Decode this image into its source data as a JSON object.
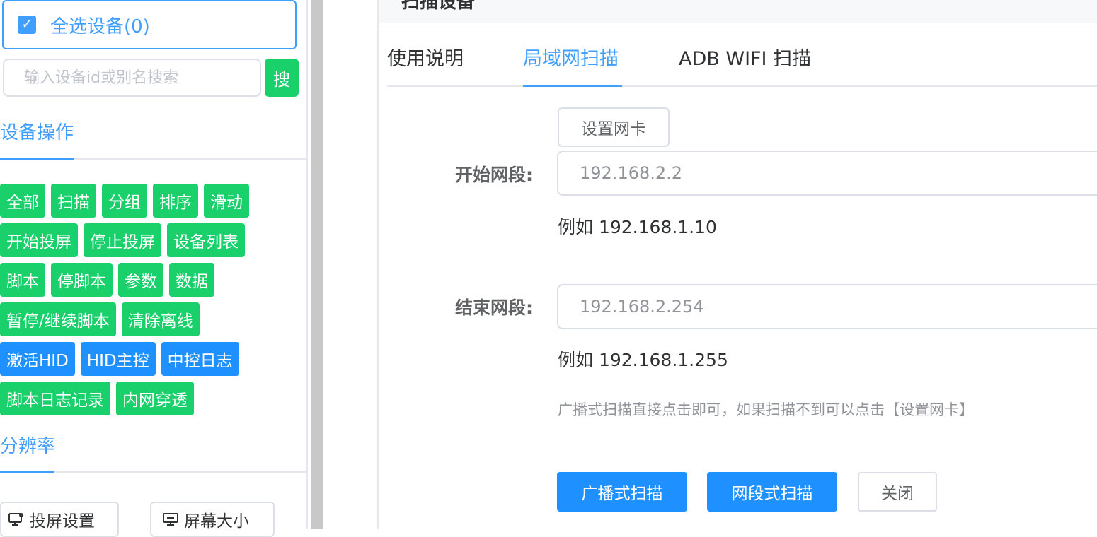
{
  "sidebar": {
    "select_all": {
      "label": "全选设备(0)",
      "checked": true
    },
    "search": {
      "placeholder": "输入设备id或别名搜索",
      "button_label": "搜"
    },
    "device_ops": {
      "title": "设备操作",
      "rows": [
        [
          {
            "label": "全部",
            "color": "green"
          },
          {
            "label": "扫描",
            "color": "green"
          },
          {
            "label": "分组",
            "color": "green"
          },
          {
            "label": "排序",
            "color": "green"
          },
          {
            "label": "滑动",
            "color": "green"
          }
        ],
        [
          {
            "label": "开始投屏",
            "color": "green"
          },
          {
            "label": "停止投屏",
            "color": "green"
          },
          {
            "label": "设备列表",
            "color": "green"
          }
        ],
        [
          {
            "label": "脚本",
            "color": "green"
          },
          {
            "label": "停脚本",
            "color": "green"
          },
          {
            "label": "参数",
            "color": "green"
          },
          {
            "label": "数据",
            "color": "green"
          }
        ],
        [
          {
            "label": "暂停/继续脚本",
            "color": "green"
          },
          {
            "label": "清除离线",
            "color": "green"
          }
        ],
        [
          {
            "label": "激活HID",
            "color": "blue"
          },
          {
            "label": "HID主控",
            "color": "blue"
          },
          {
            "label": "中控日志",
            "color": "blue"
          }
        ],
        [
          {
            "label": "脚本日志记录",
            "color": "green"
          },
          {
            "label": "内网穿透",
            "color": "green"
          }
        ]
      ]
    },
    "resolution": {
      "title": "分辨率",
      "cast_settings_label": "投屏设置",
      "screen_size_label": "屏幕大小"
    }
  },
  "colors": {
    "green": "#19d06a",
    "blue": "#1e90ff",
    "accent": "#409eff"
  },
  "dialog": {
    "title": "扫描设备",
    "tabs": [
      {
        "label": "使用说明",
        "active": false
      },
      {
        "label": "局域网扫描",
        "active": true
      },
      {
        "label": "ADB WIFI 扫描",
        "active": false
      }
    ],
    "set_nic_label": "设置网卡",
    "start_segment": {
      "label": "开始网段:",
      "value": "192.168.2.2",
      "example": "例如 192.168.1.10"
    },
    "end_segment": {
      "label": "结束网段:",
      "value": "192.168.2.254",
      "example": "例如 192.168.1.255"
    },
    "tip": "广播式扫描直接点击即可，如果扫描不到可以点击【设置网卡】",
    "buttons": {
      "broadcast_scan": "广播式扫描",
      "segment_scan": "网段式扫描",
      "close": "关闭"
    }
  }
}
